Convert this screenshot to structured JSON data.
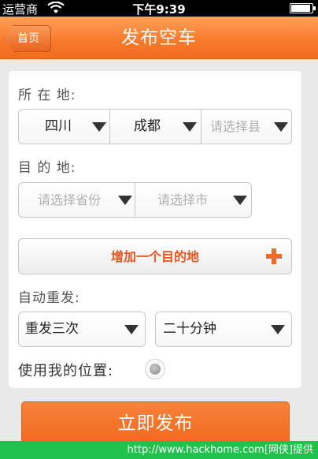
{
  "status_bar": {
    "carrier": "运营商",
    "time": "下午9:39",
    "battery_level": 0.92
  },
  "nav": {
    "back_label": "首页",
    "title": "发布空车"
  },
  "location": {
    "label": "所 在 地:",
    "province": "四川",
    "city": "成都",
    "county_placeholder": "请选择县"
  },
  "destination": {
    "label": "目 的 地:",
    "province_placeholder": "请选择省份",
    "city_placeholder": "请选择市"
  },
  "add_destination_label": "增加一个目的地",
  "auto_repeat": {
    "label": "自动重发:",
    "times": "重发三次",
    "interval": "二十分钟"
  },
  "use_location_label": "使用我的位置:",
  "publish_label": "立即发布",
  "watermark": "http://www.hackhome.com[网侠]提供",
  "colors": {
    "accent": "#f8792a",
    "add_text": "#e8541d",
    "watermark_bg": "#1fc24a"
  }
}
